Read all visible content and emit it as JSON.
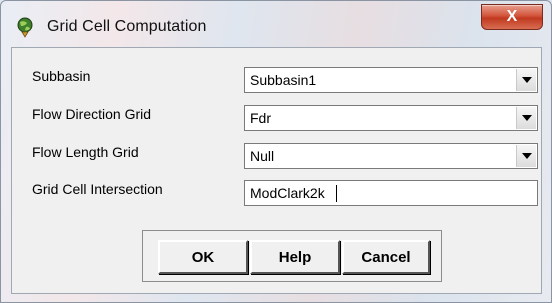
{
  "window": {
    "title": "Grid Cell Computation",
    "close_label": "X"
  },
  "form": {
    "fields": [
      {
        "label": "Subbasin",
        "value": "Subbasin1",
        "type": "combo"
      },
      {
        "label": "Flow Direction Grid",
        "value": "Fdr",
        "type": "combo"
      },
      {
        "label": "Flow Length Grid",
        "value": "Null",
        "type": "combo"
      },
      {
        "label": "Grid Cell Intersection",
        "value": "ModClark2k",
        "type": "text"
      }
    ]
  },
  "buttons": {
    "ok": "OK",
    "help": "Help",
    "cancel": "Cancel"
  }
}
